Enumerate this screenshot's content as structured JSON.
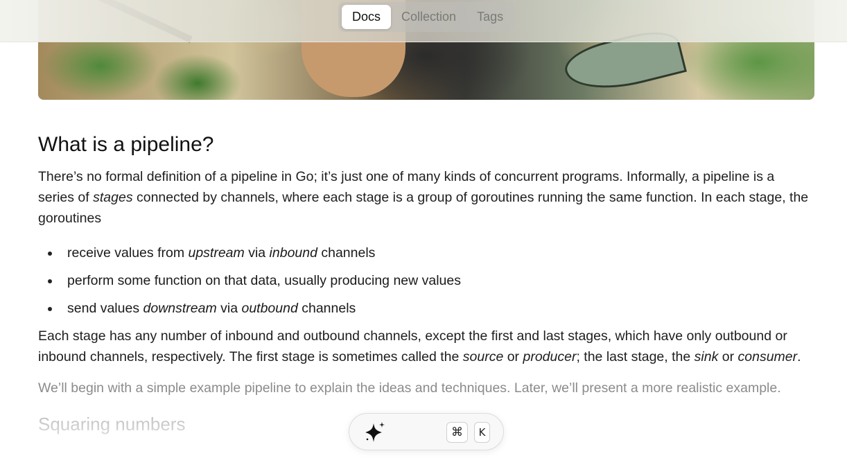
{
  "nav": {
    "tabs": [
      {
        "label": "Docs",
        "active": true
      },
      {
        "label": "Collection",
        "active": false
      },
      {
        "label": "Tags",
        "active": false
      }
    ]
  },
  "article": {
    "heading": "What is a pipeline?",
    "intro": {
      "t1": "There’s no formal definition of a pipeline in Go; it’s just one of many kinds of concurrent programs. Informally, a pipeline is a series of ",
      "em1": "stages",
      "t2": " connected by channels, where each stage is a group of goroutines running the same function. In each stage, the goroutines"
    },
    "bullets": [
      {
        "t1": "receive values from ",
        "em1": "upstream",
        "t2": " via ",
        "em2": "inbound",
        "t3": " channels"
      },
      {
        "t1": "perform some function on that data, usually producing new values"
      },
      {
        "t1": "send values ",
        "em1": "downstream",
        "t2": " via ",
        "em2": "outbound",
        "t3": " channels"
      }
    ],
    "stages": {
      "t1": "Each stage has any number of inbound and outbound channels, except the first and last stages, which have only outbound or inbound channels, respectively. The first stage is sometimes called the ",
      "em1": "source",
      "t2": " or ",
      "em2": "producer",
      "t3": "; the last stage, the ",
      "em3": "sink",
      "t4": " or ",
      "em4": "consumer",
      "t5": "."
    },
    "example": "We’ll begin with a simple example pipeline to explain the ideas and techniques. Later, we’ll present a more realistic example.",
    "next_heading": "Squaring numbers"
  },
  "assistant": {
    "icon": "sparkle-icon",
    "shortcut_mod": "⌘",
    "shortcut_key": "K"
  }
}
